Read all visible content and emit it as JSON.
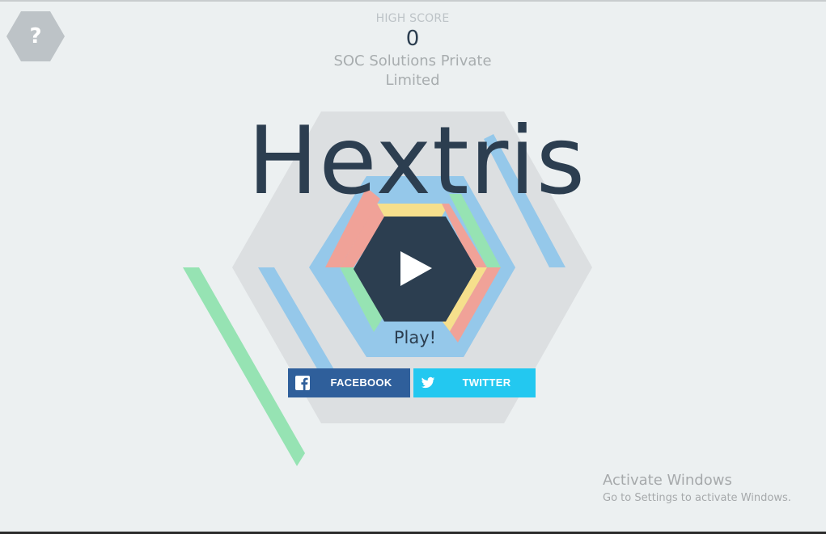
{
  "help": {
    "label": "?",
    "icon": "hexagon-help-icon"
  },
  "score": {
    "label": "HIGH SCORE",
    "value": "0"
  },
  "company": {
    "line1": "SOC Solutions Private",
    "line2": "Limited"
  },
  "title": "Hextris",
  "play": {
    "label": "Play!",
    "icon": "play-triangle-icon"
  },
  "share": {
    "facebook": {
      "label": "FACEBOOK",
      "icon": "facebook-icon"
    },
    "twitter": {
      "label": "TWITTER",
      "icon": "twitter-icon"
    }
  },
  "watermark": {
    "title": "Activate Windows",
    "subtitle": "Go to Settings to activate Windows."
  },
  "colors": {
    "background": "#ecf0f1",
    "hex_backdrop": "#dcdfe1",
    "center_hex": "#2c3e50",
    "blue": "#8dc3e8",
    "green": "#8fe1b1",
    "yellow": "#f5df8a",
    "red": "#ef9f95",
    "facebook": "#2f5f9b",
    "twitter": "#23c8f0"
  }
}
